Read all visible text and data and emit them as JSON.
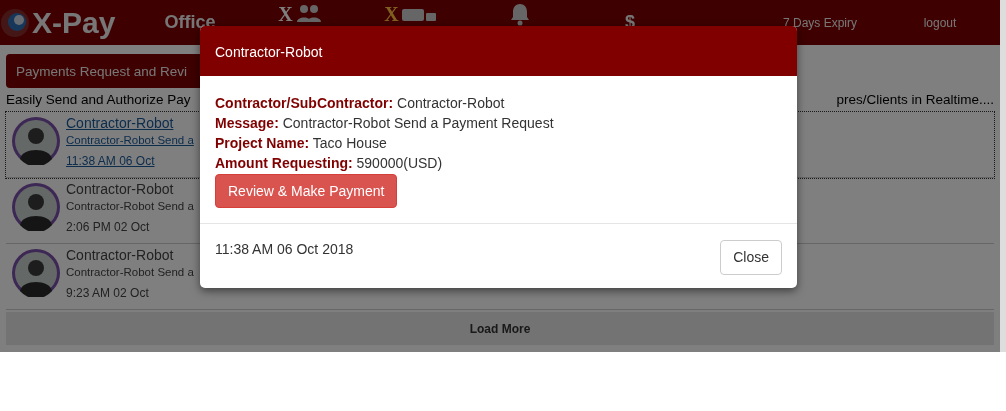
{
  "navbar": {
    "logo_text": "X-Pay",
    "items": [
      {
        "kind": "text",
        "label": "Office"
      },
      {
        "kind": "group",
        "label": "X"
      },
      {
        "kind": "truck",
        "label": "X"
      },
      {
        "kind": "bell"
      },
      {
        "kind": "text",
        "label": "$"
      }
    ],
    "right_links": [
      "7 Days Expiry",
      "logout"
    ]
  },
  "panel": {
    "heading": "Payments Request and Revi",
    "subtitle_left": "Easily Send and Authorize Pay",
    "subtitle_right": "pres/Clients in Realtime....",
    "items": [
      {
        "name": "Contractor-Robot",
        "message": "Contractor-Robot Send a",
        "time": "11:38 AM 06 Oct",
        "selected": true
      },
      {
        "name": "Contractor-Robot",
        "message": "Contractor-Robot Send a",
        "time": "2:06 PM 02 Oct",
        "selected": false
      },
      {
        "name": "Contractor-Robot",
        "message": "Contractor-Robot Send a",
        "time": "9:23 AM 02 Oct",
        "selected": false
      }
    ],
    "load_more": "Load More"
  },
  "modal": {
    "title": "Contractor-Robot",
    "fields": [
      {
        "label": "Contractor/SubContractor:",
        "value": "Contractor-Robot"
      },
      {
        "label": "Message:",
        "value": "Contractor-Robot Send a Payment Request"
      },
      {
        "label": "Project Name:",
        "value": "Taco House"
      },
      {
        "label": "Amount Requesting:",
        "value": "590000(USD)"
      }
    ],
    "action_button": "Review & Make Payment",
    "timestamp": "11:38 AM 06 Oct 2018",
    "close_button": "Close"
  }
}
